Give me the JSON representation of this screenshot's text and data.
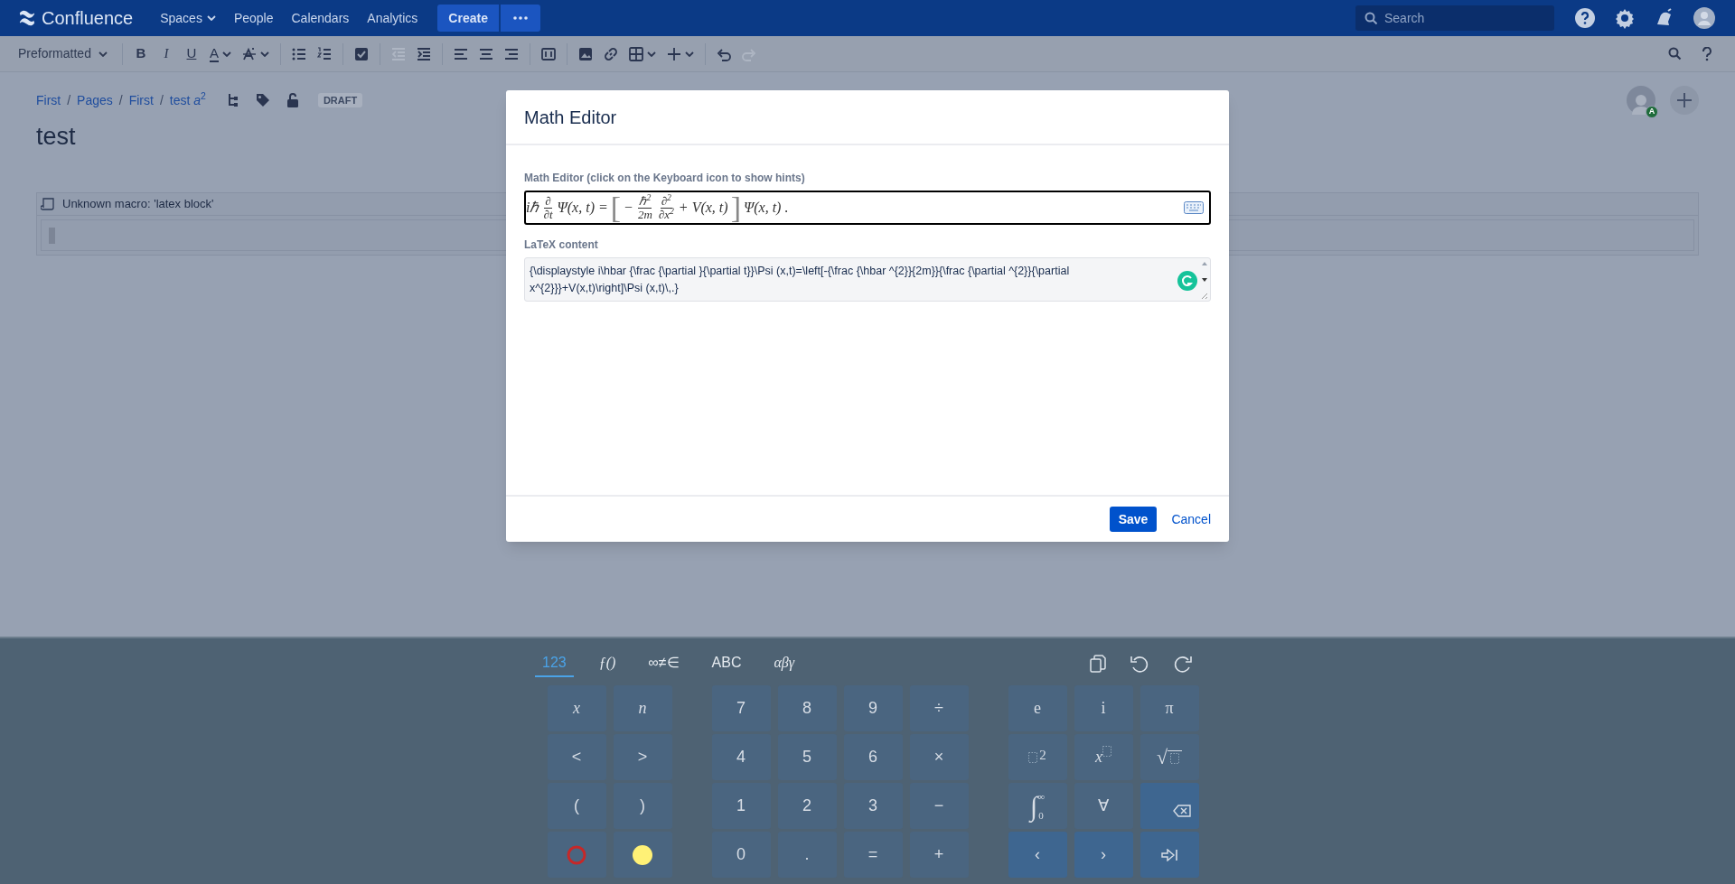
{
  "nav": {
    "logo": "Confluence",
    "items": [
      {
        "label": "Spaces",
        "dropdown": true
      },
      {
        "label": "People",
        "dropdown": false
      },
      {
        "label": "Calendars",
        "dropdown": false
      },
      {
        "label": "Analytics",
        "dropdown": false
      }
    ],
    "create": "Create",
    "search": {
      "placeholder": "Search"
    }
  },
  "toolbar": {
    "style_menu": "Preformatted",
    "buttons": [
      {
        "kind": "sep"
      },
      {
        "kind": "bold",
        "label": "B",
        "disabled": false
      },
      {
        "kind": "italic",
        "label": "I",
        "disabled": false
      },
      {
        "kind": "underline",
        "label": "U",
        "disabled": false
      },
      {
        "kind": "color",
        "label": "A",
        "disabled": false
      },
      {
        "kind": "format",
        "disabled": false
      },
      {
        "kind": "sep"
      },
      {
        "kind": "bullets",
        "disabled": false
      },
      {
        "kind": "numbers",
        "disabled": false
      },
      {
        "kind": "sep"
      },
      {
        "kind": "task",
        "disabled": false
      },
      {
        "kind": "sep"
      },
      {
        "kind": "outdent",
        "disabled": true
      },
      {
        "kind": "indent",
        "disabled": false
      },
      {
        "kind": "sep"
      },
      {
        "kind": "align-left",
        "disabled": false
      },
      {
        "kind": "align-center",
        "disabled": false
      },
      {
        "kind": "align-right",
        "disabled": false
      },
      {
        "kind": "sep"
      },
      {
        "kind": "layout",
        "disabled": false
      },
      {
        "kind": "sep"
      },
      {
        "kind": "image",
        "disabled": false
      },
      {
        "kind": "link",
        "disabled": false
      },
      {
        "kind": "table",
        "disabled": false
      },
      {
        "kind": "insert",
        "disabled": false
      },
      {
        "kind": "sep"
      },
      {
        "kind": "undo",
        "disabled": false
      },
      {
        "kind": "redo",
        "disabled": true
      }
    ]
  },
  "breadcrumbs": {
    "separator": "/",
    "items": [
      "First",
      "Pages",
      "First",
      "test *a*$^{2}$"
    ],
    "badge": "DRAFT"
  },
  "avatar_badge": "A",
  "title": "test",
  "macro": {
    "label": "Unknown macro: 'latex block'"
  },
  "dialog": {
    "title": "Math Editor",
    "math_label": "Math Editor (click on the Keyboard icon to show hints)",
    "math_parts": [
      {
        "kind": "text",
        "text": "iℏ"
      },
      {
        "kind": "frac",
        "num": "∂",
        "den": "∂t"
      },
      {
        "kind": "text",
        "text": "Ψ(x, t) ="
      },
      {
        "kind": "bracket",
        "text": "["
      },
      {
        "kind": "text",
        "text": "−"
      },
      {
        "kind": "frac",
        "num": "ℏ$^{2}$",
        "den": "2m"
      },
      {
        "kind": "frac",
        "num": "∂$^{2}$",
        "den": "∂x$^{2}$"
      },
      {
        "kind": "text",
        "text": "+ V(x, t)"
      },
      {
        "kind": "bracket",
        "text": "]"
      },
      {
        "kind": "text",
        "text": "Ψ(x, t) ."
      }
    ],
    "latex_label": "LaTeX content",
    "latex": "{\\displaystyle i\\hbar {\\frac {\\partial }{\\partial t}}\\Psi (x,t)=\\left[-{\\frac {\\hbar ^{2}}{2m}}{\\frac {\\partial ^{2}}{\\partial x^{2}}}+V(x,t)\\right]\\Psi (x,t)\\,.}",
    "save": "Save",
    "cancel": "Cancel"
  },
  "keyboard": {
    "tabs": [
      {
        "label": "123",
        "selected": true
      },
      {
        "label": "ƒ()",
        "selected": false
      },
      {
        "label": "∞≠∈",
        "selected": false
      },
      {
        "label": "ABC",
        "selected": false
      },
      {
        "label": "αβγ",
        "selected": false
      }
    ],
    "groups": [
      {
        "rows": [
          [
            {
              "kind": "var",
              "label": "x"
            },
            {
              "kind": "var",
              "label": "n"
            }
          ],
          [
            {
              "kind": "char",
              "label": "<"
            },
            {
              "kind": "char",
              "label": ">"
            }
          ],
          [
            {
              "kind": "char",
              "label": "("
            },
            {
              "kind": "char",
              "label": ")"
            }
          ],
          [
            {
              "kind": "ring",
              "color": "#c62828"
            },
            {
              "kind": "dot",
              "color": "#fff176"
            }
          ]
        ]
      },
      {
        "rows": [
          [
            {
              "kind": "char",
              "label": "7"
            },
            {
              "kind": "char",
              "label": "8"
            },
            {
              "kind": "char",
              "label": "9"
            },
            {
              "kind": "char",
              "label": "÷"
            }
          ],
          [
            {
              "kind": "char",
              "label": "4"
            },
            {
              "kind": "char",
              "label": "5"
            },
            {
              "kind": "char",
              "label": "6"
            },
            {
              "kind": "char",
              "label": "×"
            }
          ],
          [
            {
              "kind": "char",
              "label": "1"
            },
            {
              "kind": "char",
              "label": "2"
            },
            {
              "kind": "char",
              "label": "3"
            },
            {
              "kind": "char",
              "label": "−"
            }
          ],
          [
            {
              "kind": "char",
              "label": "0"
            },
            {
              "kind": "char",
              "label": "."
            },
            {
              "kind": "char",
              "label": "="
            },
            {
              "kind": "char",
              "label": "+"
            }
          ]
        ]
      },
      {
        "rows": [
          [
            {
              "kind": "serif",
              "label": "e"
            },
            {
              "kind": "serif",
              "label": "i"
            },
            {
              "kind": "serif",
              "label": "π"
            }
          ],
          [
            {
              "kind": "square-power",
              "label": "2"
            },
            {
              "kind": "var-power",
              "label": "x"
            },
            {
              "kind": "sqrt",
              "label": "√"
            }
          ],
          [
            {
              "kind": "integral",
              "label": "∫",
              "sup": "∞",
              "sub": "0"
            },
            {
              "kind": "serif",
              "label": "∀"
            },
            {
              "kind": "backspace"
            }
          ],
          [
            {
              "kind": "action",
              "label": "‹"
            },
            {
              "kind": "action",
              "label": "›"
            },
            {
              "kind": "tab-next"
            }
          ]
        ]
      }
    ]
  }
}
